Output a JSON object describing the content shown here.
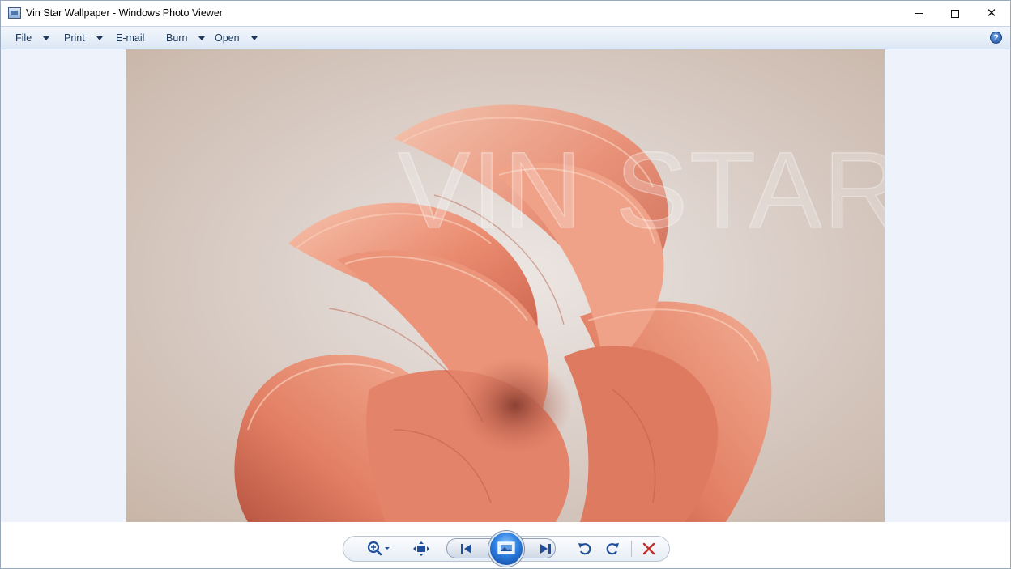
{
  "window": {
    "title": "Vin Star Wallpaper - Windows Photo Viewer",
    "controls": [
      "minimize",
      "maximize",
      "close"
    ]
  },
  "commandbar": {
    "items": [
      {
        "label": "File",
        "has_dropdown": true
      },
      {
        "label": "Print",
        "has_dropdown": true
      },
      {
        "label": "E-mail",
        "has_dropdown": false
      },
      {
        "label": "Burn",
        "has_dropdown": true
      },
      {
        "label": "Open",
        "has_dropdown": true
      }
    ],
    "help_icon": "help-icon"
  },
  "photo": {
    "watermark": "VIN STAR",
    "subject": "abstract coral ribbon bloom on beige background",
    "colors": {
      "ribbon": "#e9836a",
      "ribbon_light": "#f4b49c",
      "background": "#e6ddd8"
    }
  },
  "toolbar": {
    "buttons": [
      {
        "name": "zoom",
        "icon": "zoom-icon",
        "has_dropdown": true
      },
      {
        "name": "actual-size",
        "icon": "fit-window-icon"
      },
      {
        "name": "previous",
        "icon": "previous-icon"
      },
      {
        "name": "slideshow",
        "icon": "slideshow-icon"
      },
      {
        "name": "next",
        "icon": "next-icon"
      },
      {
        "name": "rotate-counterclockwise",
        "icon": "rotate-left-icon"
      },
      {
        "name": "rotate-clockwise",
        "icon": "rotate-right-icon"
      },
      {
        "name": "delete",
        "icon": "delete-icon"
      }
    ],
    "accent": "#2d7fe0",
    "delete_color": "#c0302a"
  }
}
